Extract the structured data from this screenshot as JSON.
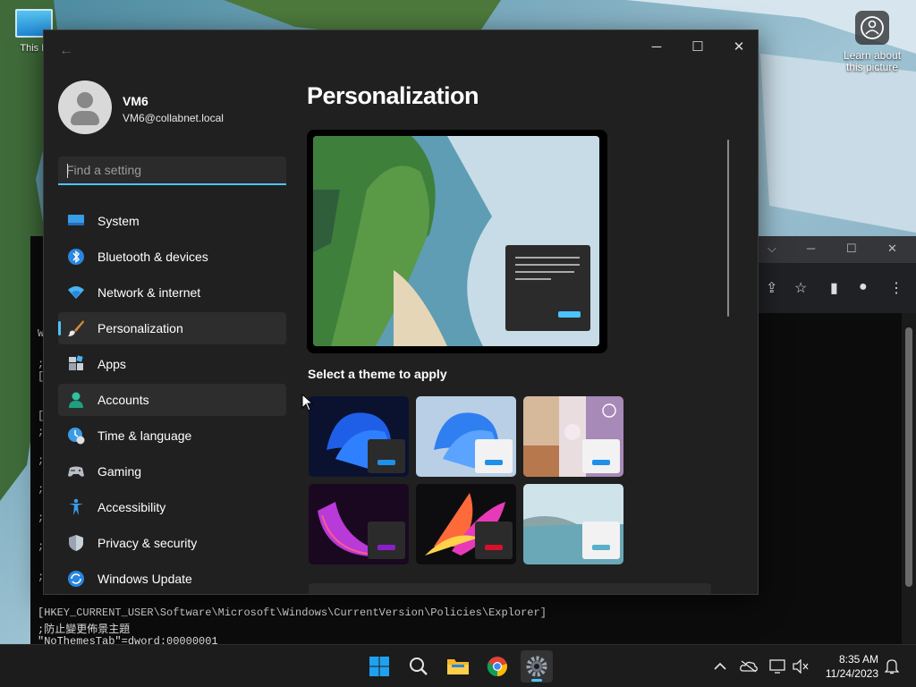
{
  "desktop": {
    "icon_label": "This P",
    "learn_label": "Learn about this picture"
  },
  "terminal": {
    "lines_left": [
      "W",
      ";",
      "[",
      "[",
      ";",
      ";",
      ";",
      ";",
      ";",
      ";"
    ],
    "registry_key": "[HKEY_CURRENT_USER\\Software\\Microsoft\\Windows\\CurrentVersion\\Policies\\Explorer]",
    "comment": ";防止變更佈景主題",
    "value_line": "\"NoThemesTab\"=dword:00000001"
  },
  "settings": {
    "back_icon": "back-arrow-icon",
    "controls": {
      "minimize": "─",
      "maximize": "☐",
      "close": "✕"
    },
    "user": {
      "name": "VM6",
      "email": "VM6@collabnet.local"
    },
    "search": {
      "placeholder": "Find a setting"
    },
    "nav": [
      {
        "label": "System",
        "icon": "system-icon"
      },
      {
        "label": "Bluetooth & devices",
        "icon": "bluetooth-icon"
      },
      {
        "label": "Network & internet",
        "icon": "network-icon"
      },
      {
        "label": "Personalization",
        "icon": "brush-icon",
        "selected": true
      },
      {
        "label": "Apps",
        "icon": "apps-icon"
      },
      {
        "label": "Accounts",
        "icon": "accounts-icon",
        "hover": true
      },
      {
        "label": "Time & language",
        "icon": "time-language-icon"
      },
      {
        "label": "Gaming",
        "icon": "gaming-icon"
      },
      {
        "label": "Accessibility",
        "icon": "accessibility-icon"
      },
      {
        "label": "Privacy & security",
        "icon": "shield-icon"
      },
      {
        "label": "Windows Update",
        "icon": "update-icon"
      }
    ],
    "page_title": "Personalization",
    "section_label": "Select a theme to apply",
    "themes": [
      {
        "name": "windows-dark",
        "accent": "#1e90e8"
      },
      {
        "name": "windows-light",
        "accent": "#1e90e8"
      },
      {
        "name": "windows-spotlight",
        "accent": "#1e90e8"
      },
      {
        "name": "glow",
        "accent": "#8a1fc8"
      },
      {
        "name": "captured-motion",
        "accent": "#d8102a"
      },
      {
        "name": "flow",
        "accent": "#5ab0c8"
      }
    ]
  },
  "taskbar": {
    "apps": [
      "start-icon",
      "search-icon",
      "file-explorer-icon",
      "chrome-icon",
      "settings-icon"
    ],
    "time": "8:35 AM",
    "date": "11/24/2023"
  },
  "colors": {
    "accent": "#4cc2ff",
    "window_bg": "#202020",
    "selected_bg": "#2d2d2d"
  }
}
